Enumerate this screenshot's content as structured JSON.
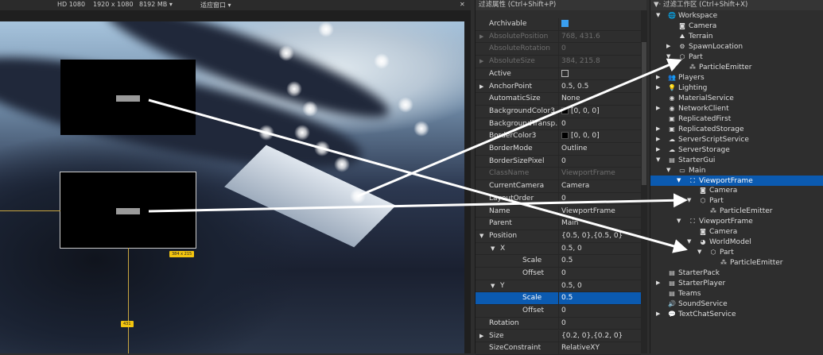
{
  "viewport": {
    "device": "HD 1080",
    "resolution": "1920 x 1080",
    "memory": "8192 MB ▾",
    "fit": "适应窗口 ▾",
    "close": "✕",
    "size_tag": "384 x 215",
    "pos_tag": "431"
  },
  "properties": {
    "title": "过滤属性 (Ctrl+Shift+P)",
    "rows": [
      {
        "k": "Archivable",
        "v": "",
        "check": true
      },
      {
        "k": "AbsolutePosition",
        "v": "768, 431.6",
        "dim": true,
        "tri": "▶"
      },
      {
        "k": "AbsoluteRotation",
        "v": "0",
        "dim": true
      },
      {
        "k": "AbsoluteSize",
        "v": "384, 215.8",
        "dim": true,
        "tri": "▶"
      },
      {
        "k": "Active",
        "v": "",
        "check": false
      },
      {
        "k": "AnchorPoint",
        "v": "0.5, 0.5",
        "tri": "▶"
      },
      {
        "k": "AutomaticSize",
        "v": "None"
      },
      {
        "k": "BackgroundColor3",
        "v": "[0, 0, 0]",
        "swatch": true
      },
      {
        "k": "BackgroundTransp...",
        "v": "0"
      },
      {
        "k": "BorderColor3",
        "v": "[0, 0, 0]",
        "swatch": true
      },
      {
        "k": "BorderMode",
        "v": "Outline"
      },
      {
        "k": "BorderSizePixel",
        "v": "0"
      },
      {
        "k": "ClassName",
        "v": "ViewportFrame",
        "dim": true
      },
      {
        "k": "CurrentCamera",
        "v": "Camera"
      },
      {
        "k": "LayoutOrder",
        "v": "0"
      },
      {
        "k": "Name",
        "v": "ViewportFrame"
      },
      {
        "k": "Parent",
        "v": "Main"
      },
      {
        "k": "Position",
        "v": "{0.5, 0},{0.5, 0}",
        "tri": "▼"
      },
      {
        "k": "X",
        "v": "0.5, 0",
        "tri": "▼",
        "indent": 1
      },
      {
        "k": "Scale",
        "v": "0.5",
        "indent": 2
      },
      {
        "k": "Offset",
        "v": "0",
        "indent": 2
      },
      {
        "k": "Y",
        "v": "0.5, 0",
        "tri": "▼",
        "indent": 1
      },
      {
        "k": "Scale",
        "v": "0.5",
        "indent": 2,
        "sel": true
      },
      {
        "k": "Offset",
        "v": "0",
        "indent": 2
      },
      {
        "k": "Rotation",
        "v": "0"
      },
      {
        "k": "Size",
        "v": "{0.2, 0},{0.2, 0}",
        "tri": "▶"
      },
      {
        "k": "SizeConstraint",
        "v": "RelativeXY"
      }
    ]
  },
  "explorer": {
    "title": "过滤工作区 (Ctrl+Shift+X)",
    "rows": [
      {
        "t": "Workspace",
        "d": 0,
        "a": "▼",
        "i": "🌐",
        "icon": "workspace-icon"
      },
      {
        "t": "Camera",
        "d": 1,
        "i": "◙",
        "icon": "camera-icon"
      },
      {
        "t": "Terrain",
        "d": 1,
        "i": "⛰",
        "icon": "terrain-icon"
      },
      {
        "t": "SpawnLocation",
        "d": 1,
        "a": "▶",
        "i": "⚙",
        "icon": "spawn-icon"
      },
      {
        "t": "Part",
        "d": 1,
        "a": "▼",
        "i": "⬡",
        "icon": "part-icon"
      },
      {
        "t": "ParticleEmitter",
        "d": 2,
        "i": "⁂",
        "icon": "particle-icon"
      },
      {
        "t": "Players",
        "d": 0,
        "a": "▶",
        "i": "👥",
        "icon": "players-icon"
      },
      {
        "t": "Lighting",
        "d": 0,
        "a": "▶",
        "i": "💡",
        "icon": "lighting-icon"
      },
      {
        "t": "MaterialService",
        "d": 0,
        "i": "◉",
        "icon": "material-icon"
      },
      {
        "t": "NetworkClient",
        "d": 0,
        "a": "▶",
        "i": "◉",
        "icon": "network-icon"
      },
      {
        "t": "ReplicatedFirst",
        "d": 0,
        "i": "▣",
        "icon": "replicated-first-icon"
      },
      {
        "t": "ReplicatedStorage",
        "d": 0,
        "a": "▶",
        "i": "▣",
        "icon": "replicated-storage-icon"
      },
      {
        "t": "ServerScriptService",
        "d": 0,
        "a": "▶",
        "i": "☁",
        "icon": "server-script-icon"
      },
      {
        "t": "ServerStorage",
        "d": 0,
        "a": "▶",
        "i": "☁",
        "icon": "server-storage-icon"
      },
      {
        "t": "StarterGui",
        "d": 0,
        "a": "▼",
        "i": "▤",
        "icon": "starter-gui-icon"
      },
      {
        "t": "Main",
        "d": 1,
        "a": "▼",
        "i": "▭",
        "icon": "screengui-icon"
      },
      {
        "t": "ViewportFrame",
        "d": 2,
        "a": "▼",
        "i": "⛶",
        "icon": "viewport-icon",
        "sel": true
      },
      {
        "t": "Camera",
        "d": 3,
        "i": "◙",
        "icon": "camera-icon"
      },
      {
        "t": "Part",
        "d": 3,
        "a": "▼",
        "i": "⬡",
        "icon": "part-icon"
      },
      {
        "t": "ParticleEmitter",
        "d": 4,
        "i": "⁂",
        "icon": "particle-icon"
      },
      {
        "t": "ViewportFrame",
        "d": 2,
        "a": "▼",
        "i": "⛶",
        "icon": "viewport-icon"
      },
      {
        "t": "Camera",
        "d": 3,
        "i": "◙",
        "icon": "camera-icon"
      },
      {
        "t": "WorldModel",
        "d": 3,
        "a": "▼",
        "i": "◕",
        "icon": "worldmodel-icon"
      },
      {
        "t": "Part",
        "d": 4,
        "a": "▼",
        "i": "⬡",
        "icon": "part-icon"
      },
      {
        "t": "ParticleEmitter",
        "d": 5,
        "i": "⁂",
        "icon": "particle-icon"
      },
      {
        "t": "StarterPack",
        "d": 0,
        "i": "▤",
        "icon": "starter-pack-icon"
      },
      {
        "t": "StarterPlayer",
        "d": 0,
        "a": "▶",
        "i": "▤",
        "icon": "starter-player-icon"
      },
      {
        "t": "Teams",
        "d": 0,
        "i": "▤",
        "icon": "teams-icon"
      },
      {
        "t": "SoundService",
        "d": 0,
        "i": "🔊",
        "icon": "sound-icon"
      },
      {
        "t": "TextChatService",
        "d": 0,
        "a": "▶",
        "i": "💬",
        "icon": "textchat-icon"
      }
    ]
  }
}
